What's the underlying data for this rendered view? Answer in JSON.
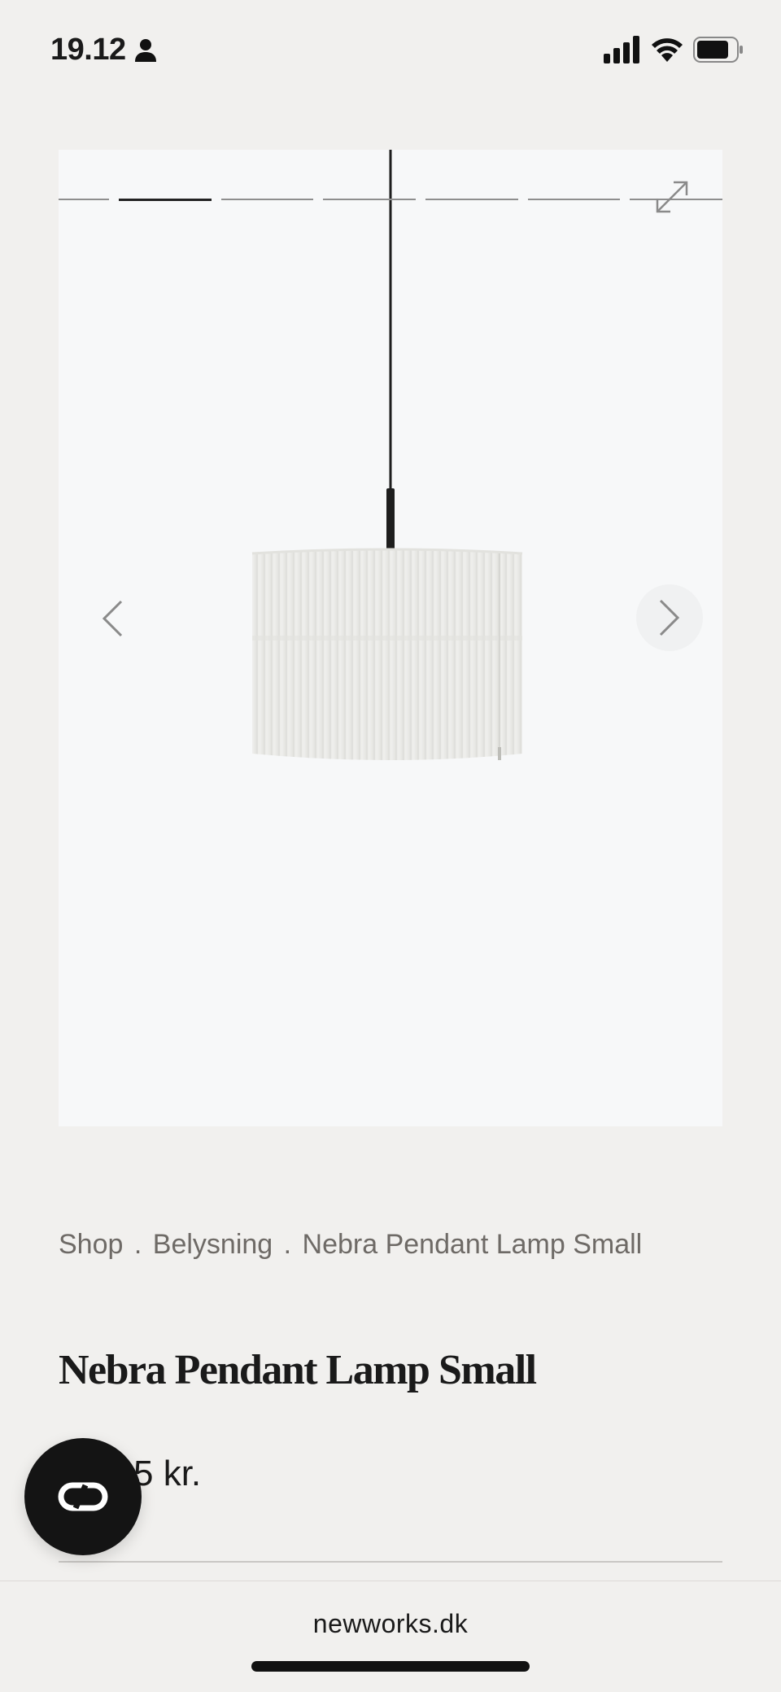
{
  "status_bar": {
    "time": "19.12",
    "icons": [
      "person-icon",
      "cellular-signal-icon",
      "wifi-icon",
      "battery-icon"
    ]
  },
  "gallery": {
    "image_count": 7,
    "active_index": 1,
    "controls": [
      "expand-icon",
      "chevron-left-icon",
      "chevron-right-icon"
    ]
  },
  "breadcrumb": {
    "items": [
      "Shop",
      "Belysning",
      "Nebra Pendant Lamp Small"
    ],
    "separator": "."
  },
  "product": {
    "title": "Nebra Pendant Lamp Small",
    "price_visible": "5 kr."
  },
  "chat": {
    "icon": "chat-bubble-icon"
  },
  "browser": {
    "url": "newworks.dk"
  },
  "colors": {
    "background": "#f1f0ee",
    "gallery_background": "#f7f8f9",
    "text": "#1a1a1a",
    "muted_text": "#6e6a66",
    "fab": "#141414"
  }
}
